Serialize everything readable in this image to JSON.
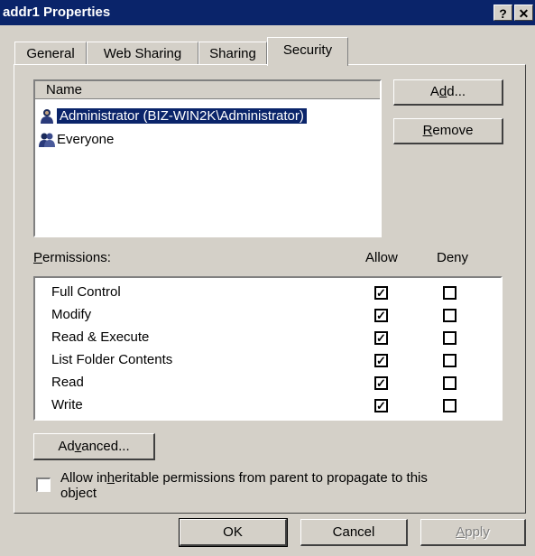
{
  "window": {
    "title": "addr1 Properties",
    "help_button": "?",
    "close_button": "✕"
  },
  "tabs": [
    {
      "label": "General",
      "active": false
    },
    {
      "label": "Web Sharing",
      "active": false
    },
    {
      "label": "Sharing",
      "active": false
    },
    {
      "label": "Security",
      "active": true
    }
  ],
  "users": {
    "header": "Name",
    "items": [
      {
        "label": "Administrator (BIZ-WIN2K\\Administrator)",
        "icon": "user-icon",
        "selected": true
      },
      {
        "label": "Everyone",
        "icon": "group-icon",
        "selected": false
      }
    ],
    "add_button": {
      "prefix": "A",
      "underline": "d",
      "suffix": "d..."
    },
    "remove_button": {
      "prefix": "",
      "underline": "R",
      "suffix": "emove"
    }
  },
  "permissions": {
    "label_underline": "P",
    "label_rest": "ermissions:",
    "allow_header": "Allow",
    "deny_header": "Deny",
    "items": [
      {
        "name": "Full Control",
        "allow": true,
        "deny": false
      },
      {
        "name": "Modify",
        "allow": true,
        "deny": false
      },
      {
        "name": "Read & Execute",
        "allow": true,
        "deny": false
      },
      {
        "name": "List Folder Contents",
        "allow": true,
        "deny": false
      },
      {
        "name": "Read",
        "allow": true,
        "deny": false
      },
      {
        "name": "Write",
        "allow": true,
        "deny": false
      }
    ]
  },
  "advanced_button": {
    "prefix": "Ad",
    "underline": "v",
    "suffix": "anced..."
  },
  "inherit": {
    "checked": false,
    "line1_prefix": "Allow in",
    "line1_underline": "h",
    "line1_suffix": "eritable permissions from parent to propagate to this",
    "line2": "object"
  },
  "footer": {
    "ok": "OK",
    "cancel": "Cancel",
    "apply_prefix": "",
    "apply_underline": "A",
    "apply_suffix": "pply"
  },
  "colors": {
    "title_bar": "#0a246a",
    "selection": "#0a246a",
    "dialog_face": "#d4d0c8"
  }
}
